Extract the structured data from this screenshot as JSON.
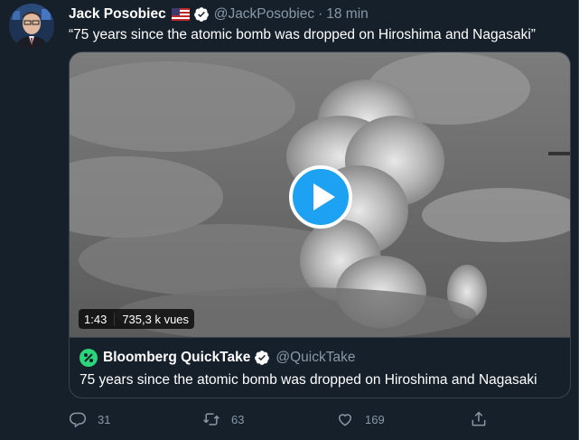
{
  "tweet": {
    "author_name": "Jack Posobiec",
    "author_handle": "@JackPosobiec",
    "separator": "·",
    "time": "18 min",
    "text": "“75 years since the atomic bomb was dropped on Hiroshima and Nagasaki”",
    "flag_icon": "us-flag-icon",
    "verified_icon": "verified-badge-icon"
  },
  "video": {
    "duration": "1:43",
    "views": "735,3 k vues",
    "play_icon": "play-icon"
  },
  "quote": {
    "author_name": "Bloomberg QuickTake",
    "author_handle": "@QuickTake",
    "text": "75 years since the atomic bomb was dropped on Hiroshima and Nagasaki",
    "logo_icon": "quicktake-logo-icon"
  },
  "actions": {
    "reply_count": "31",
    "retweet_count": "63",
    "like_count": "169",
    "share_icon": "share-icon"
  },
  "colors": {
    "background": "#15202b",
    "secondary_text": "#8899a6",
    "border": "#38444d",
    "accent": "#1da1f2",
    "quicktake_green": "#2bd67b"
  }
}
